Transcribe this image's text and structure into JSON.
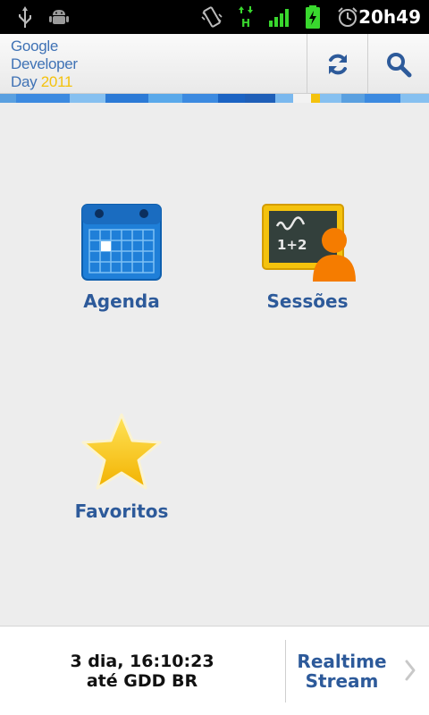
{
  "status_bar": {
    "time": "20h49",
    "icons": [
      "usb-icon",
      "android-debug-icon",
      "vibrate-icon",
      "hspa-data-icon",
      "signal-icon",
      "battery-charging-icon",
      "alarm-icon"
    ]
  },
  "action_bar": {
    "logo_line1": "Google",
    "logo_line2": "Developer",
    "logo_line3_day": "Day",
    "logo_line3_year": "2011",
    "refresh_icon": "refresh-icon",
    "search_icon": "search-icon"
  },
  "colors": {
    "accent_blue": "#2d5a9a",
    "logo_blue": "#3f72b5",
    "logo_yellow": "#f4c20d"
  },
  "dashboard": {
    "items": [
      {
        "label": "Agenda",
        "icon": "calendar-icon"
      },
      {
        "label": "Sessões",
        "icon": "chalkboard-icon"
      },
      {
        "label": "Favoritos",
        "icon": "star-icon"
      }
    ]
  },
  "footer": {
    "countdown_line1": "3 dia, 16:10:23",
    "countdown_line2": "até GDD BR",
    "realtime_line1": "Realtime",
    "realtime_line2": "Stream"
  }
}
